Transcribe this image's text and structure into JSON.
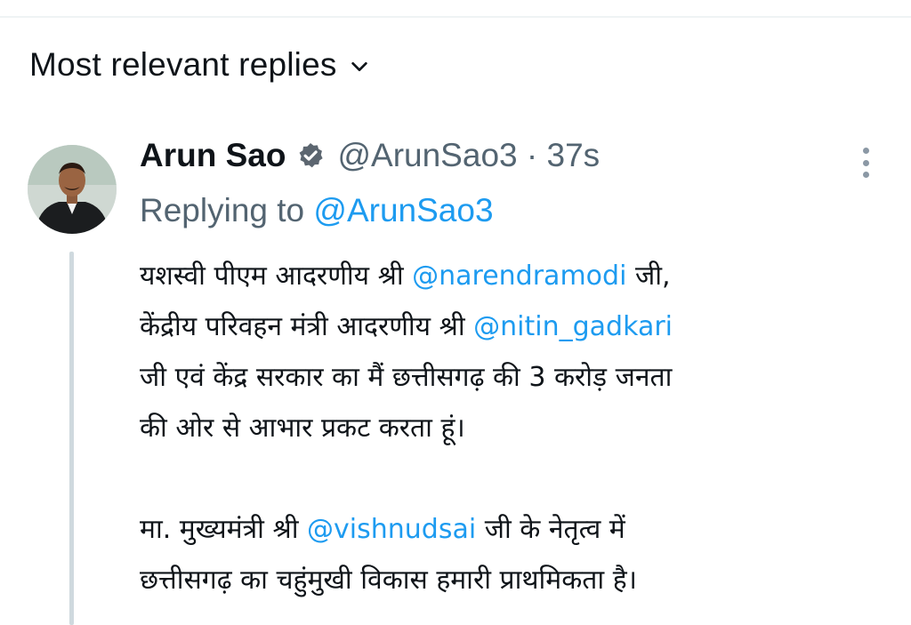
{
  "sort": {
    "label": "Most relevant replies",
    "icon": "chevron-down-icon"
  },
  "tweet": {
    "author_name": "Arun Sao",
    "verified_icon": "verified-badge-icon",
    "handle": "@ArunSao3",
    "separator": " · ",
    "time": "37s",
    "replying_prefix": "Replying to ",
    "replying_handle": "@ArunSao3",
    "lines": [
      {
        "t1": "यशस्वी पीएम आदरणीय श्री ",
        "mention": "@narendramodi",
        "t2": " जी,"
      },
      {
        "t1": "केंद्रीय परिवहन मंत्री आदरणीय श्री ",
        "mention": "@nitin_gadkari",
        "t2": ""
      },
      {
        "t1": "जी एवं केंद्र सरकार का मैं छत्तीसगढ़ की 3 करोड़ जनता",
        "mention": "",
        "t2": ""
      },
      {
        "t1": "की ओर से आभार प्रकट करता हूं।",
        "mention": "",
        "t2": ""
      },
      {
        "t1": "मा. मुख्यमंत्री श्री ",
        "mention": "@vishnudsai",
        "t2": " जी के नेतृत्व में"
      },
      {
        "t1": "छत्तीसगढ़ का चहुंमुखी विकास हमारी प्राथमिकता है।",
        "mention": "",
        "t2": ""
      }
    ]
  },
  "colors": {
    "text": "#0f1419",
    "muted": "#536471",
    "link": "#1d9bf0",
    "divider": "#eff3f4",
    "thread_line": "#cfd9de"
  }
}
